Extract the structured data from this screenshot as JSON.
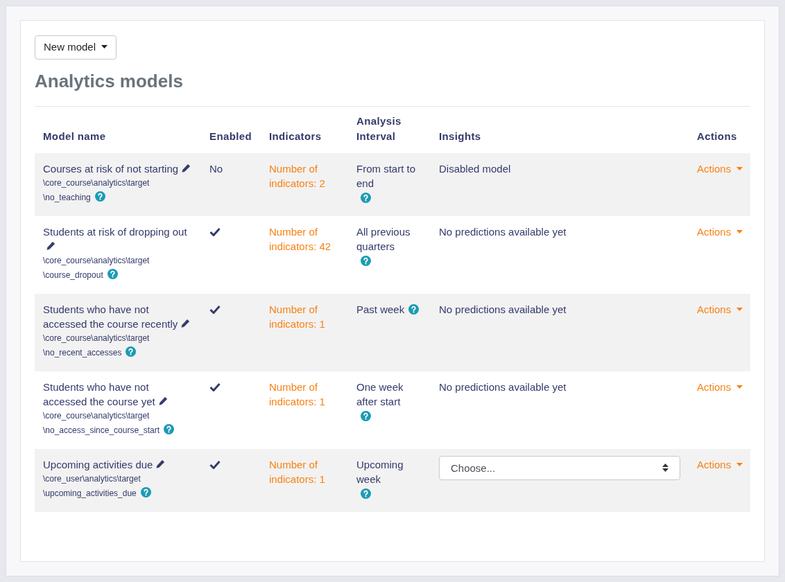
{
  "new_model_button": "New model",
  "title": "Analytics models",
  "table": {
    "columns": [
      "Model name",
      "Enabled",
      "Indicators",
      "Analysis Interval",
      "Insights",
      "Actions"
    ],
    "rows": [
      {
        "name": "Courses at risk of not starting",
        "target": [
          "\\core_course\\analytics\\target",
          "\\no_teaching"
        ],
        "enabled": false,
        "enabled_text": "No",
        "indicators": "Number of indicators: 2",
        "interval": "From start to end",
        "insights": {
          "kind": "text",
          "text": "Disabled model"
        },
        "actions": "Actions"
      },
      {
        "name": "Students at risk of dropping out",
        "target": [
          "\\core_course\\analytics\\target",
          "\\course_dropout"
        ],
        "enabled": true,
        "indicators": "Number of indicators: 42",
        "interval": "All previous quarters",
        "insights": {
          "kind": "text",
          "text": "No predictions available yet"
        },
        "actions": "Actions"
      },
      {
        "name": "Students who have not accessed the course recently",
        "target": [
          "\\core_course\\analytics\\target",
          "\\no_recent_accesses"
        ],
        "enabled": true,
        "indicators": "Number of indicators: 1",
        "interval": "Past week",
        "insights": {
          "kind": "text",
          "text": "No predictions available yet"
        },
        "actions": "Actions"
      },
      {
        "name": "Students who have not accessed the course yet",
        "target": [
          "\\core_course\\analytics\\target",
          "\\no_access_since_course_start"
        ],
        "enabled": true,
        "indicators": "Number of indicators: 1",
        "interval": "One week after start",
        "insights": {
          "kind": "text",
          "text": "No predictions available yet"
        },
        "actions": "Actions"
      },
      {
        "name": "Upcoming activities due",
        "target": [
          "\\core_user\\analytics\\target",
          "\\upcoming_activities_due"
        ],
        "enabled": true,
        "indicators": "Number of indicators: 1",
        "interval": "Upcoming week",
        "insights": {
          "kind": "select",
          "value": "Choose..."
        },
        "actions": "Actions"
      }
    ]
  }
}
